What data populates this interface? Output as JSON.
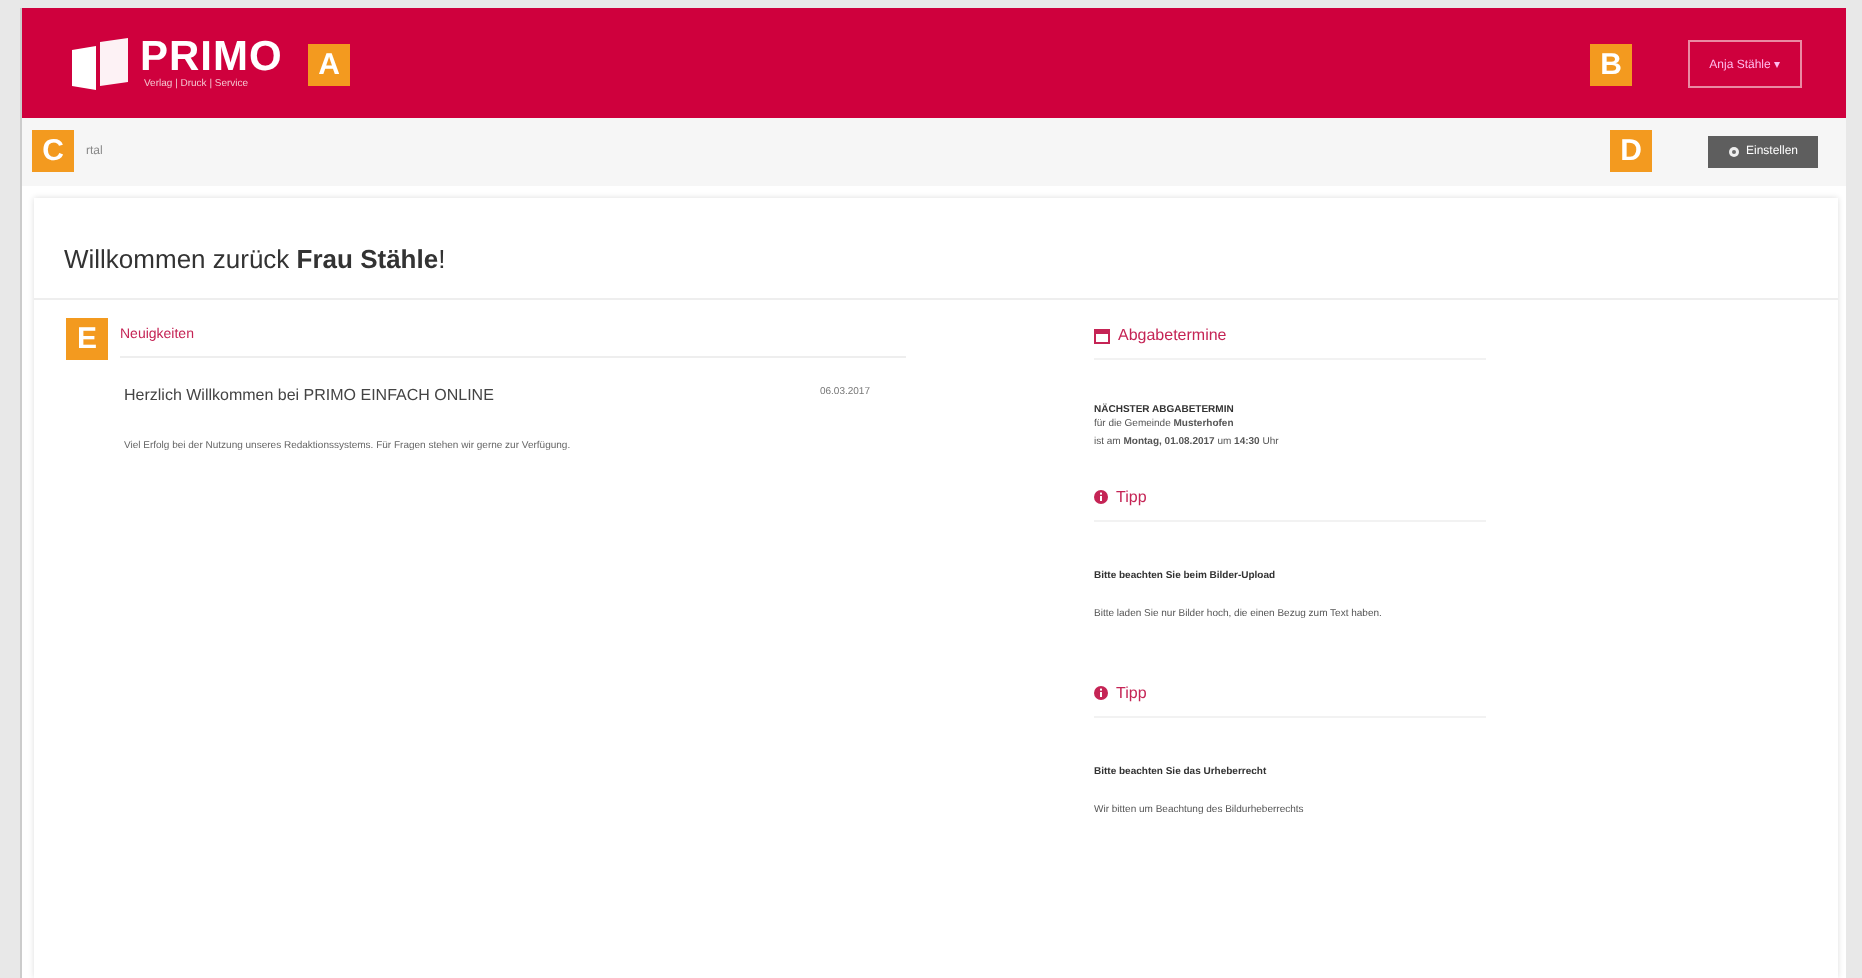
{
  "header": {
    "logo_title": "PRIMO",
    "logo_subtitle": "Verlag | Druck | Service",
    "user_menu": "Anja Stähle ▾"
  },
  "breadcrumb": {
    "text": "rtal"
  },
  "settings_button": "Einstellen",
  "welcome": "Willkommen zurück **Frau Stähle**!",
  "news": {
    "heading": "Neuigkeiten",
    "items": [
      {
        "title": "Herzlich Willkommen bei PRIMO EINFACH ONLINE",
        "date": "06.03.2017",
        "body": "Viel Erfolg bei der Nutzung unseres Redaktionssystems. Für Fragen stehen wir gerne zur Verfügung."
      }
    ]
  },
  "sidebar": [
    {
      "kind": "deadline",
      "heading": "Abgabetermine",
      "title": "NÄCHSTER ABGABETERMIN",
      "lines": [
        "für die Gemeinde **Musterhofen**",
        "ist am **Montag, 01.08.2017** um **14:30** Uhr"
      ]
    },
    {
      "kind": "tip",
      "heading": "Tipp",
      "title": "Bitte beachten Sie beim Bilder-Upload",
      "lines": [
        "Bitte laden Sie nur Bilder hoch, die einen Bezug zum Text haben."
      ]
    },
    {
      "kind": "tip",
      "heading": "Tipp",
      "title": "Bitte beachten Sie das Urheberrecht",
      "lines": [
        "Wir bitten um Beachtung des Bildurheberrechts"
      ]
    }
  ],
  "callouts": [
    {
      "label": "A",
      "kind": "logo"
    },
    {
      "label": "B",
      "kind": "user"
    },
    {
      "label": "C",
      "kind": "breadcrumb"
    },
    {
      "label": "D",
      "kind": "settings"
    },
    {
      "label": "E",
      "kind": "news"
    }
  ]
}
